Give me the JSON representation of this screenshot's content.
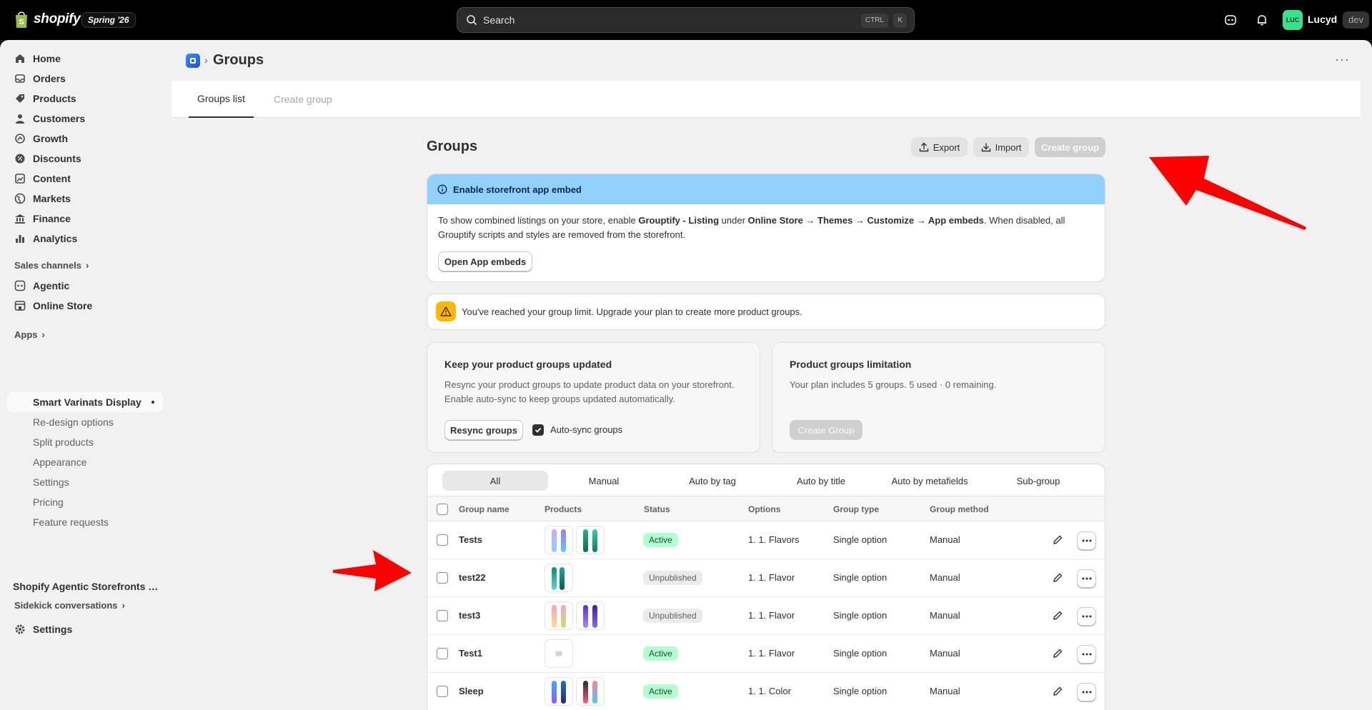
{
  "topbar": {
    "logo_text": "shopify",
    "edition": "Spring '26",
    "search_placeholder": "Search",
    "kbd_ctrl": "CTRL",
    "kbd_k": "K",
    "avatar_initials": "LUC",
    "user_name": "Lucyd",
    "env_badge": "dev"
  },
  "sidebar": {
    "items": [
      {
        "label": "Home",
        "icon": "home-icon"
      },
      {
        "label": "Orders",
        "icon": "orders-icon"
      },
      {
        "label": "Products",
        "icon": "tag-icon"
      },
      {
        "label": "Customers",
        "icon": "person-icon"
      },
      {
        "label": "Growth",
        "icon": "growth-icon"
      },
      {
        "label": "Discounts",
        "icon": "discount-icon"
      },
      {
        "label": "Content",
        "icon": "content-icon"
      },
      {
        "label": "Markets",
        "icon": "globe-icon"
      },
      {
        "label": "Finance",
        "icon": "bank-icon"
      },
      {
        "label": "Analytics",
        "icon": "chart-icon"
      }
    ],
    "sales_channels_label": "Sales channels",
    "channels": [
      {
        "label": "Agentic",
        "icon": "agentic-icon"
      },
      {
        "label": "Online Store",
        "icon": "store-icon"
      }
    ],
    "apps_label": "Apps",
    "app_items": [
      {
        "label": "Smart Varinats Display",
        "active": true
      },
      {
        "label": "Re-design options"
      },
      {
        "label": "Split products"
      },
      {
        "label": "Appearance"
      },
      {
        "label": "Settings"
      },
      {
        "label": "Pricing"
      },
      {
        "label": "Feature requests"
      }
    ],
    "sidekick_label": "Sidekick conversations",
    "sidekick_item": "Shopify Agentic Storefronts ov...",
    "settings_label": "Settings"
  },
  "page": {
    "title": "Groups",
    "more": "···",
    "tabs": [
      {
        "label": "Groups list",
        "active": true
      },
      {
        "label": "Create group",
        "active": false
      }
    ]
  },
  "content": {
    "title": "Groups",
    "export_label": "Export",
    "import_label": "Import",
    "create_label": "Create group",
    "banner": {
      "title": "Enable storefront app embed",
      "text_1": "To show combined listings on your store, enable ",
      "bold_1": "Grouptify - Listing",
      "text_2": " under ",
      "bold_2": "Online Store → Themes → Customize → App embeds",
      "text_3": ". When disabled, all Grouptify scripts and styles are removed from the storefront.",
      "button": "Open App embeds"
    },
    "warning": "You've reached your group limit. Upgrade your plan to create more product groups.",
    "resync_card": {
      "title": "Keep your product groups updated",
      "text": "Resync your product groups to update product data on your storefront. Enable auto-sync to keep groups updated automatically.",
      "button": "Resync groups",
      "checkbox_label": "Auto-sync groups"
    },
    "limit_card": {
      "title": "Product groups limitation",
      "text": "Your plan includes 5 groups. 5 used · 0 remaining.",
      "button": "Create Group"
    }
  },
  "table": {
    "filters": [
      "All",
      "Manual",
      "Auto by tag",
      "Auto by title",
      "Auto by metafields",
      "Sub-group"
    ],
    "headers": [
      "Group name",
      "Products",
      "Status",
      "Options",
      "Group type",
      "Group method"
    ],
    "rows": [
      {
        "name": "Tests",
        "status": "Active",
        "options": "1. 1. Flavors",
        "type": "Single option",
        "method": "Manual"
      },
      {
        "name": "test22",
        "status": "Unpublished",
        "options": "1. 1. Flavor",
        "type": "Single option",
        "method": "Manual"
      },
      {
        "name": "test3",
        "status": "Unpublished",
        "options": "1. 1. Flavor",
        "type": "Single option",
        "method": "Manual"
      },
      {
        "name": "Test1",
        "status": "Active",
        "options": "1. 1. Flavor",
        "type": "Single option",
        "method": "Manual"
      },
      {
        "name": "Sleep",
        "status": "Active",
        "options": "1. 1. Color",
        "type": "Single option",
        "method": "Manual"
      }
    ]
  },
  "colors": {
    "annotation_arrow": "#ff0000",
    "banner_bg": "#91d0ff",
    "active_badge": "#b4fed2"
  }
}
